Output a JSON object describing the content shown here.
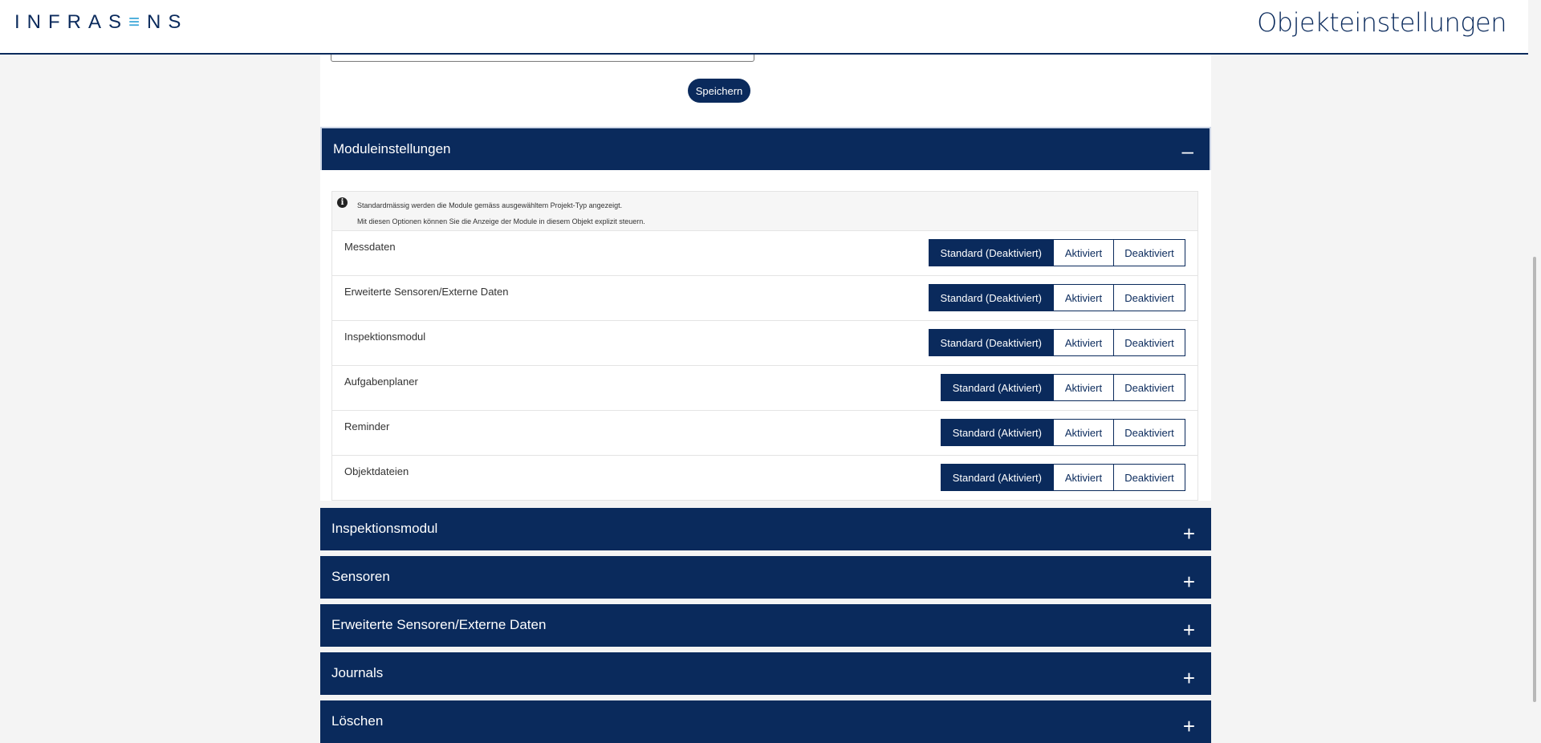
{
  "header": {
    "logo_text_a": "INFRAS",
    "logo_text_b": "≡",
    "logo_text_c": "NS",
    "title": "Objekteinstellungen"
  },
  "previous_section": {
    "save_label": "Speichern"
  },
  "module_settings": {
    "title": "Moduleinstellungen",
    "toggle": "–",
    "info_icon": "info-icon",
    "info_line_1": "Standardmässig werden die Module gemäss ausgewähltem Projekt-Typ angezeigt.",
    "info_line_2": "Mit diesen Optionen können Sie die Anzeige der Module in diesem Objekt explizit steuern.",
    "option_activated": "Aktiviert",
    "option_deactivated": "Deaktiviert",
    "modules": [
      {
        "name": "Messdaten",
        "standard_label": "Standard (Deaktiviert)",
        "selected": "standard"
      },
      {
        "name": "Erweiterte Sensoren/Externe Daten",
        "standard_label": "Standard (Deaktiviert)",
        "selected": "standard"
      },
      {
        "name": "Inspektionsmodul",
        "standard_label": "Standard (Deaktiviert)",
        "selected": "standard"
      },
      {
        "name": "Aufgabenplaner",
        "standard_label": "Standard (Aktiviert)",
        "selected": "standard"
      },
      {
        "name": "Reminder",
        "standard_label": "Standard (Aktiviert)",
        "selected": "standard"
      },
      {
        "name": "Objektdateien",
        "standard_label": "Standard (Aktiviert)",
        "selected": "standard"
      }
    ]
  },
  "collapsed_sections": [
    {
      "title": "Inspektionsmodul",
      "toggle": "+"
    },
    {
      "title": "Sensoren",
      "toggle": "+"
    },
    {
      "title": "Erweiterte Sensoren/Externe Daten",
      "toggle": "+"
    },
    {
      "title": "Journals",
      "toggle": "+"
    },
    {
      "title": "Löschen",
      "toggle": "+"
    }
  ],
  "colors": {
    "primary": "#0a2a5c",
    "logo_accent": "#3aa6d8",
    "background": "#f4f4f4"
  }
}
